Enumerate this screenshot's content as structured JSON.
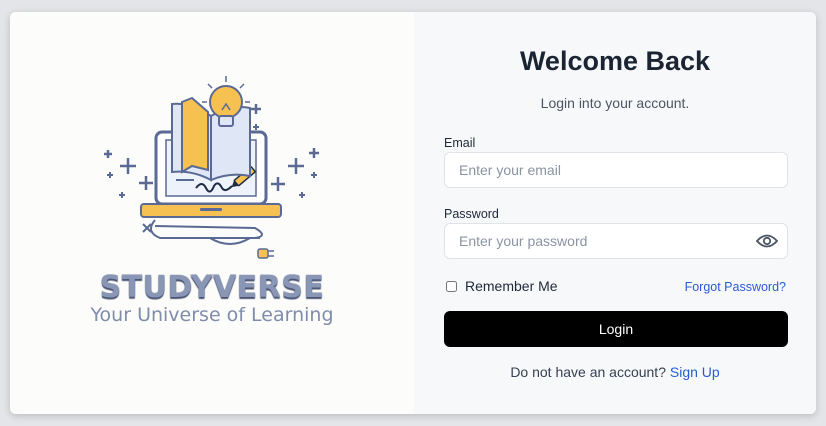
{
  "brand": {
    "name": "STUDYVERSE",
    "tagline": "Your Universe of Learning"
  },
  "login": {
    "title": "Welcome Back",
    "subtitle": "Login into your account.",
    "email_label": "Email",
    "email_placeholder": "Enter your email",
    "email_value": "",
    "password_label": "Password",
    "password_placeholder": "Enter your password",
    "password_value": "",
    "remember_label": "Remember Me",
    "remember_checked": false,
    "forgot_label": "Forgot Password?",
    "submit_label": "Login",
    "signup_prompt": "Do not have an account?",
    "signup_link": "Sign Up"
  },
  "icons": {
    "password_toggle": "eye-icon",
    "logo": "laptop-book-lightbulb-illustration"
  },
  "colors": {
    "button_bg": "#000000",
    "link": "#2a5bd7",
    "brand_text": "#8a96b6",
    "left_panel_bg": "#fcfcfa",
    "right_panel_bg": "#f7f8fa"
  }
}
